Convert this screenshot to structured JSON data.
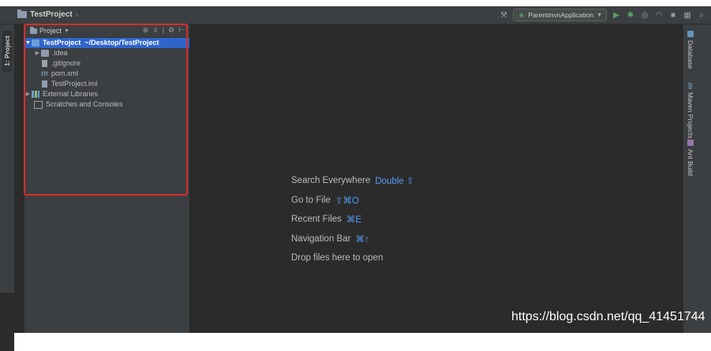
{
  "window": {
    "breadcrumb": "TestProject",
    "run_config": "ParentmvnApplication"
  },
  "left_strip": {
    "tab_label": "1: Project"
  },
  "project_panel": {
    "title": "Project",
    "root": {
      "name": "TestProject",
      "path": "~/Desktop/TestProject"
    },
    "items": [
      {
        "label": ".idea",
        "icon": "folder-icon",
        "expandable": true
      },
      {
        "label": ".gitignore",
        "icon": "file-icon",
        "expandable": false
      },
      {
        "label": "pom.xml",
        "icon": "maven-icon",
        "expandable": false
      },
      {
        "label": "TestProject.iml",
        "icon": "module-file-icon",
        "expandable": false
      }
    ],
    "external": {
      "label": "External Libraries"
    },
    "scratches": {
      "label": "Scratches and Consoles"
    }
  },
  "editor": {
    "hints": [
      {
        "label": "Search Everywhere",
        "key": "Double ⇧"
      },
      {
        "label": "Go to File",
        "key": "⇧⌘O"
      },
      {
        "label": "Recent Files",
        "key": "⌘E"
      },
      {
        "label": "Navigation Bar",
        "key": "⌘↑"
      },
      {
        "label": "Drop files here to open",
        "key": ""
      }
    ]
  },
  "right_strip": {
    "tabs": [
      "Database",
      "Maven Projects",
      "Ant Build"
    ]
  },
  "watermark": "https://blog.csdn.net/qq_41451744",
  "colors": {
    "selection": "#2f65ca",
    "shortcut": "#589df6",
    "highlight_border": "#d32f2f",
    "run": "#59a869"
  }
}
